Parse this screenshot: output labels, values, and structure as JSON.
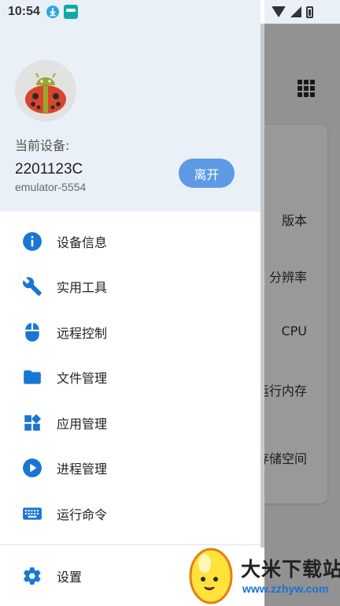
{
  "status_bar": {
    "time": "10:54",
    "icons": [
      "download-icon",
      "app-notification-icon",
      "wifi-icon",
      "signal-icon",
      "battery-icon"
    ]
  },
  "background": {
    "rows": [
      "版本",
      "分辨率",
      "CPU",
      "运行内存",
      "存储空间"
    ],
    "icons": [
      "grid-menu-icon"
    ]
  },
  "drawer": {
    "header": {
      "label": "当前设备:",
      "device_name": "2201123C",
      "device_serial": "emulator-5554",
      "leave_button": "离开"
    },
    "menu": [
      {
        "label": "设备信息",
        "icon": "info-icon"
      },
      {
        "label": "实用工具",
        "icon": "wrench-icon"
      },
      {
        "label": "远程控制",
        "icon": "mouse-icon"
      },
      {
        "label": "文件管理",
        "icon": "folder-icon"
      },
      {
        "label": "应用管理",
        "icon": "apps-icon"
      },
      {
        "label": "进程管理",
        "icon": "play-circle-icon"
      },
      {
        "label": "运行命令",
        "icon": "keyboard-icon"
      }
    ],
    "settings": {
      "label": "设置",
      "icon": "gear-icon"
    }
  },
  "watermark": {
    "name": "大米下载站",
    "url": "www.zzhyw.com"
  },
  "colors": {
    "accent": "#1976d2",
    "button": "#5d9ae3",
    "header_bg": "#e9f0f8",
    "watermark_url": "#1a6fd6"
  }
}
